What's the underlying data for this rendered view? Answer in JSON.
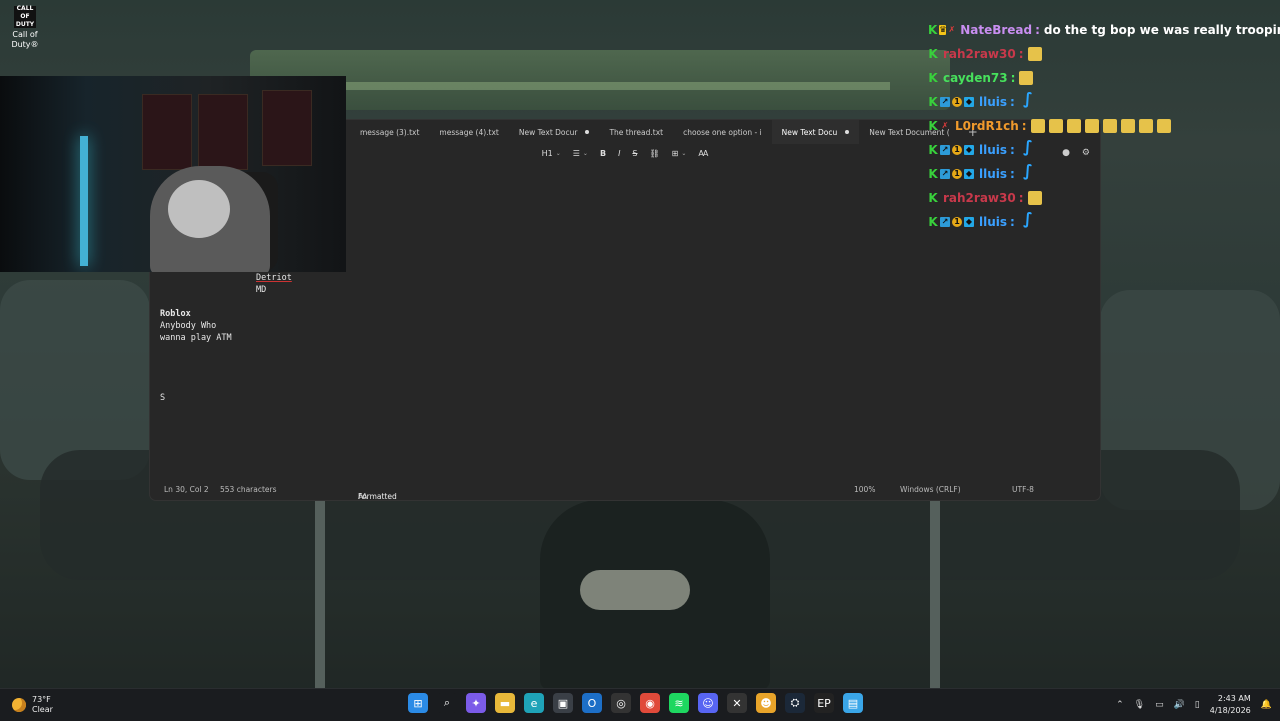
{
  "desktop_icon": {
    "label": "Call of Duty®",
    "logo_text": "CALL OF DUTY"
  },
  "notepad": {
    "tabs": [
      {
        "label": "message (3).txt",
        "modified": false,
        "active": false
      },
      {
        "label": "message (4).txt",
        "modified": false,
        "active": false
      },
      {
        "label": "New Text Docur",
        "modified": true,
        "active": false
      },
      {
        "label": "The thread.txt",
        "modified": false,
        "active": false
      },
      {
        "label": "choose one option - i",
        "modified": false,
        "active": false
      },
      {
        "label": "New Text Docu",
        "modified": true,
        "active": true
      },
      {
        "label": "New Text Document (",
        "modified": false,
        "active": false
      }
    ],
    "toolbar": {
      "heading": "H1"
    },
    "content": {
      "line1": "Detriot",
      "line2": "MD",
      "heading": "Roblox",
      "line3": "Anybody Who",
      "line4": "wanna play ATM",
      "line5": "S"
    },
    "status": {
      "position": "Ln 30, Col 2",
      "characters": "553 characters",
      "format": "Formatted",
      "zoom": "100%",
      "line_ending": "Windows (CRLF)",
      "encoding": "UTF-8"
    }
  },
  "chat": [
    {
      "badges": [
        "k",
        "crown",
        "x"
      ],
      "user": "NateBread",
      "color": "#c88ef0",
      "text": "do the tg bop we was really troopin thru tg",
      "emotes": 0
    },
    {
      "badges": [
        "k"
      ],
      "user": "rah2raw30",
      "color": "#c8394b",
      "text": "",
      "emotes": 1
    },
    {
      "badges": [
        "k"
      ],
      "user": "cayden73",
      "color": "#47e05c",
      "text": "",
      "emotes": 1
    },
    {
      "badges": [
        "k",
        "pr",
        "one",
        "cube"
      ],
      "user": "lluis",
      "color": "#3aa0ff",
      "text": "",
      "emotes": 1,
      "emote_style": "blue"
    },
    {
      "badges": [
        "k",
        "x"
      ],
      "user": "L0rdR1ch",
      "color": "#f09a2c",
      "text": "",
      "emotes": 8
    },
    {
      "badges": [
        "k",
        "pr",
        "one",
        "cube"
      ],
      "user": "lluis",
      "color": "#3aa0ff",
      "text": "",
      "emotes": 1,
      "emote_style": "blue"
    },
    {
      "badges": [
        "k",
        "pr",
        "one",
        "cube"
      ],
      "user": "lluis",
      "color": "#3aa0ff",
      "text": "",
      "emotes": 1,
      "emote_style": "blue"
    },
    {
      "badges": [
        "k"
      ],
      "user": "rah2raw30",
      "color": "#c8394b",
      "text": "",
      "emotes": 1
    },
    {
      "badges": [
        "k",
        "pr",
        "one",
        "cube"
      ],
      "user": "lluis",
      "color": "#3aa0ff",
      "text": "",
      "emotes": 1,
      "emote_style": "blue"
    }
  ],
  "taskbar": {
    "temperature": "73°F",
    "condition": "Clear",
    "time": "2:43 AM",
    "date": "4/18/2026",
    "apps": [
      "windows-start",
      "search",
      "copilot",
      "file-explorer",
      "edge",
      "microsoft-store",
      "outlook",
      "game-app",
      "chrome",
      "spotify",
      "discord",
      "xbox",
      "chat-app",
      "steam",
      "epic-games",
      "notepad"
    ]
  }
}
